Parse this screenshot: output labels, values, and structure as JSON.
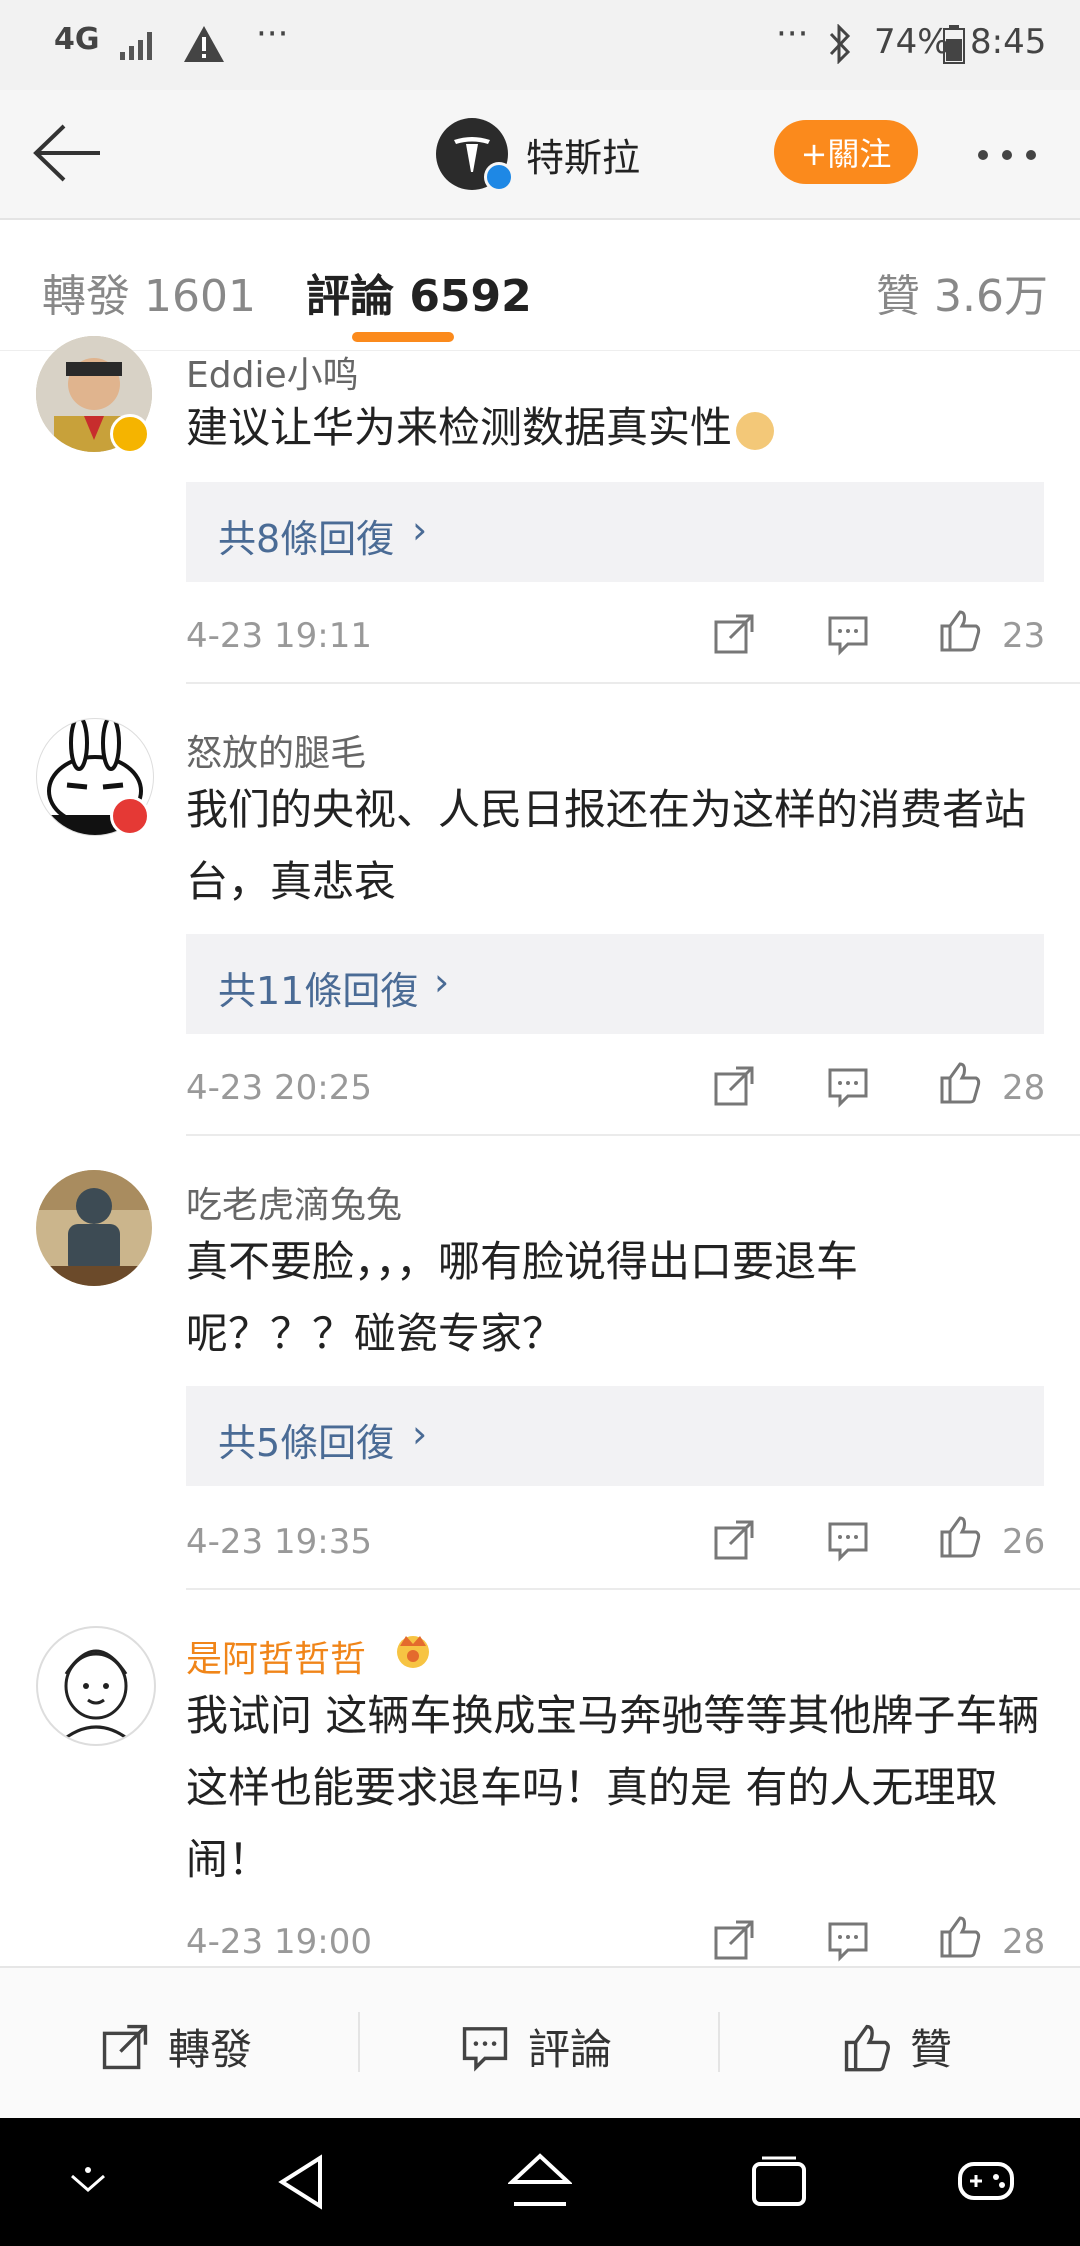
{
  "status_bar": {
    "network": "4G",
    "battery": "74%",
    "time": "8:45"
  },
  "header": {
    "account_name": "特斯拉",
    "follow_label": "+關注"
  },
  "tabs": [
    {
      "label": "轉發 1601"
    },
    {
      "label": "評論 6592"
    },
    {
      "label": "贊 3.6万"
    }
  ],
  "comments": [
    {
      "user": "Eddie小鸣",
      "text": "建议让华为来检测数据真实性",
      "emoji": "doge-emoji",
      "replies": "共8條回復",
      "time": "4-23 19:11",
      "likes": "23"
    },
    {
      "user": "怒放的腿毛",
      "text": "我们的央视、人民日报还在为这样的消费者站台，真悲哀",
      "replies": "共11條回復",
      "time": "4-23 20:25",
      "likes": "28"
    },
    {
      "user": "吃老虎滴兔兔",
      "text": "真不要脸，，，哪有脸说得出口要退车呢？？？碰瓷专家？",
      "replies": "共5條回復",
      "time": "4-23 19:35",
      "likes": "26"
    },
    {
      "user": "是阿哲哲哲",
      "user_color": "#f08519",
      "text": "我试问 这辆车换成宝马奔驰等等其他牌子车辆 这样也能要求退车吗！真的是 有的人无理取闹！",
      "time": "4-23 19:00",
      "likes": "28"
    }
  ],
  "bottom_bar": {
    "repost_label": "轉發",
    "comment_label": "評論",
    "like_label": "贊"
  },
  "colors": {
    "accent": "#fb8a1c",
    "link": "#4a6b95",
    "reply_bg": "#f2f2f4"
  }
}
